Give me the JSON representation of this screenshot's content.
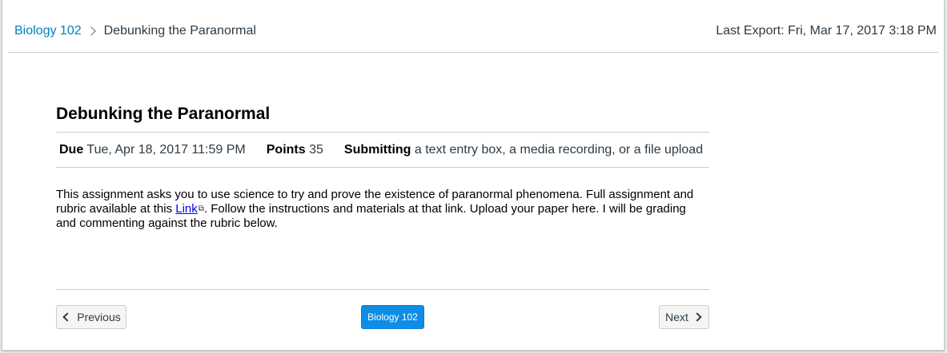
{
  "breadcrumb": {
    "course": "Biology 102",
    "current": "Debunking the Paranormal"
  },
  "header": {
    "last_export": "Last Export: Fri, Mar 17, 2017 3:18 PM"
  },
  "assignment": {
    "title": "Debunking the Paranormal",
    "due_label": "Due",
    "due_value": "Tue, Apr 18, 2017 11:59 PM",
    "points_label": "Points",
    "points_value": "35",
    "submitting_label": "Submitting",
    "submitting_value": "a text entry box, a media recording, or a file upload",
    "description_before": "This assignment asks you to use science to try and prove the existence of paranormal phenomena. Full assignment and rubric available at this ",
    "link_text": "Link",
    "description_after": ".  Follow the instructions and materials at that link. Upload your paper here. I will be grading and commenting against the rubric below."
  },
  "footer": {
    "previous_label": "Previous",
    "home_label": "Biology 102",
    "next_label": "Next"
  },
  "colors": {
    "link": "#0081bd",
    "primary_button": "#0e8de6"
  },
  "icons": {
    "breadcrumb_separator": "chevron-right-icon",
    "external_link": "external-link-icon",
    "previous": "chevron-left-icon",
    "next": "chevron-right-icon"
  }
}
